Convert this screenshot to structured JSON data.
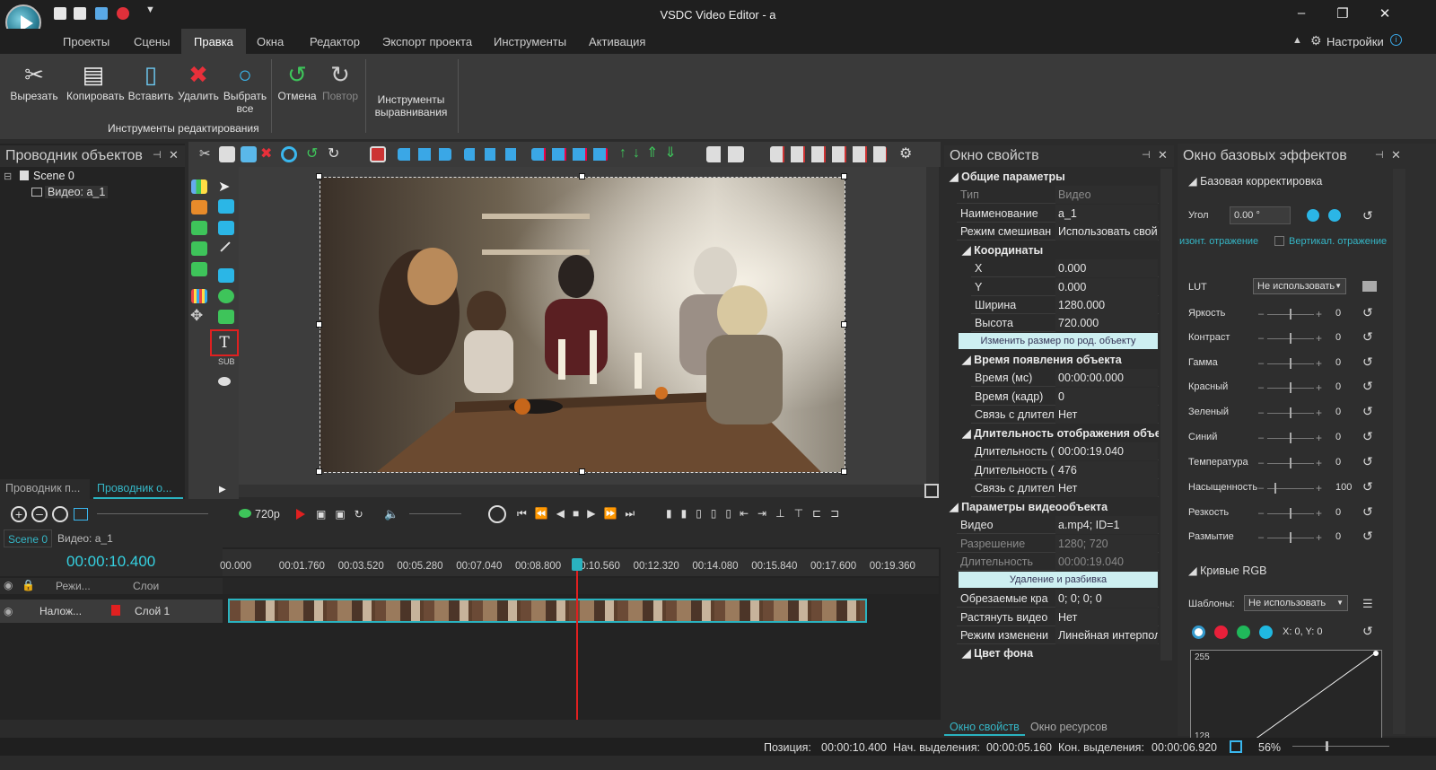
{
  "window": {
    "title": "VSDC Video Editor - a"
  },
  "menu": {
    "tabs": [
      "Проекты",
      "Сцены",
      "Правка",
      "Окна",
      "Редактор",
      "Экспорт проекта",
      "Инструменты",
      "Активация"
    ],
    "active": "Правка",
    "settings": "Настройки"
  },
  "ribbon": {
    "cut": "Вырезать",
    "copy": "Копировать",
    "paste": "Вставить",
    "delete": "Удалить",
    "select_all_1": "Выбрать",
    "select_all_2": "все",
    "undo": "Отмена",
    "redo": "Повтор",
    "align_1": "Инструменты",
    "align_2": "выравнивания",
    "group_label": "Инструменты редактирования"
  },
  "explorer": {
    "title": "Проводник объектов",
    "scene": "Scene 0",
    "video": "Видео: a_1",
    "tab1": "Проводник п...",
    "tab2": "Проводник о..."
  },
  "props": {
    "title": "Окно свойств",
    "general": "Общие параметры",
    "type_k": "Тип",
    "type_v": "Видео",
    "name_k": "Наименование",
    "name_v": "a_1",
    "blend_k": "Режим смешиван",
    "blend_v": "Использовать свойс",
    "coords": "Координаты",
    "x_k": "X",
    "x_v": "0.000",
    "y_k": "Y",
    "y_v": "0.000",
    "w_k": "Ширина",
    "w_v": "1280.000",
    "h_k": "Высота",
    "h_v": "720.000",
    "resize_btn": "Изменить размер по род. объекту",
    "appear": "Время появления объекта",
    "tms_k": "Время (мс)",
    "tms_v": "00:00:00.000",
    "tfr_k": "Время (кадр)",
    "tfr_v": "0",
    "link_k": "Связь с длител",
    "link_v": "Нет",
    "duration": "Длительность отображения объек",
    "d1_k": "Длительность (",
    "d1_v": "00:00:19.040",
    "d2_k": "Длительность (",
    "d2_v": "476",
    "link2_k": "Связь с длител",
    "link2_v": "Нет",
    "videoparams": "Параметры видеообъекта",
    "vid_k": "Видео",
    "vid_v": "a.mp4; ID=1",
    "res_k": "Разрешение",
    "res_v": "1280; 720",
    "len_k": "Длительность",
    "len_v": "00:00:19.040",
    "split_btn": "Удаление и разбивка",
    "crop_k": "Обрезаемые кра",
    "crop_v": "0; 0; 0; 0",
    "stretch_k": "Растянуть видео",
    "stretch_v": "Нет",
    "mode_k": "Режим изменени",
    "mode_v": "Линейная интерпол",
    "bg": "Цвет фона",
    "tab1": "Окно свойств",
    "tab2": "Окно ресурсов"
  },
  "effects": {
    "title": "Окно базовых эффектов",
    "basic": "Базовая корректировка",
    "angle_k": "Угол",
    "angle_v": "0.00 °",
    "hflip": "изонт. отражение",
    "vflip": "Вертикал. отражение",
    "lut_k": "LUT",
    "lut_v": "Не использовать",
    "rows": [
      {
        "label": "Яркость",
        "value": "0"
      },
      {
        "label": "Контраст",
        "value": "0"
      },
      {
        "label": "Гамма",
        "value": "0"
      },
      {
        "label": "Красный",
        "value": "0"
      },
      {
        "label": "Зеленый",
        "value": "0"
      },
      {
        "label": "Синий",
        "value": "0"
      },
      {
        "label": "Температура",
        "value": "0"
      },
      {
        "label": "Насыщенность",
        "value": "100"
      },
      {
        "label": "Резкость",
        "value": "0"
      },
      {
        "label": "Размытие",
        "value": "0"
      }
    ],
    "curves": "Кривые RGB",
    "templates_k": "Шаблоны:",
    "templates_v": "Не использовать",
    "xy": "X: 0, Y: 0",
    "curve_max": "255",
    "curve_mid": "128"
  },
  "timeline": {
    "quality": "720p",
    "tab1": "Scene 0",
    "tab2": "Видео: a_1",
    "time": "00:00:10.400",
    "ticks": [
      "00.000",
      "00:01.760",
      "00:03.520",
      "00:05.280",
      "00:07.040",
      "00:08.800",
      "00:10.560",
      "00:12.320",
      "00:14.080",
      "00:15.840",
      "00:17.600",
      "00:19.360"
    ],
    "hdr_mode": "Режи...",
    "hdr_layers": "Слои",
    "track_mode": "Налож...",
    "track_name": "Слой 1"
  },
  "status": {
    "pos_k": "Позиция:",
    "pos_v": "00:00:10.400",
    "sel_start_k": "Нач. выделения:",
    "sel_start_v": "00:00:05.160",
    "sel_end_k": "Кон. выделения:",
    "sel_end_v": "00:00:06.920",
    "zoom": "56%"
  },
  "colors": {
    "accent": "#2ab3c0",
    "playhead": "#e02020",
    "time": "#35d0e0"
  }
}
